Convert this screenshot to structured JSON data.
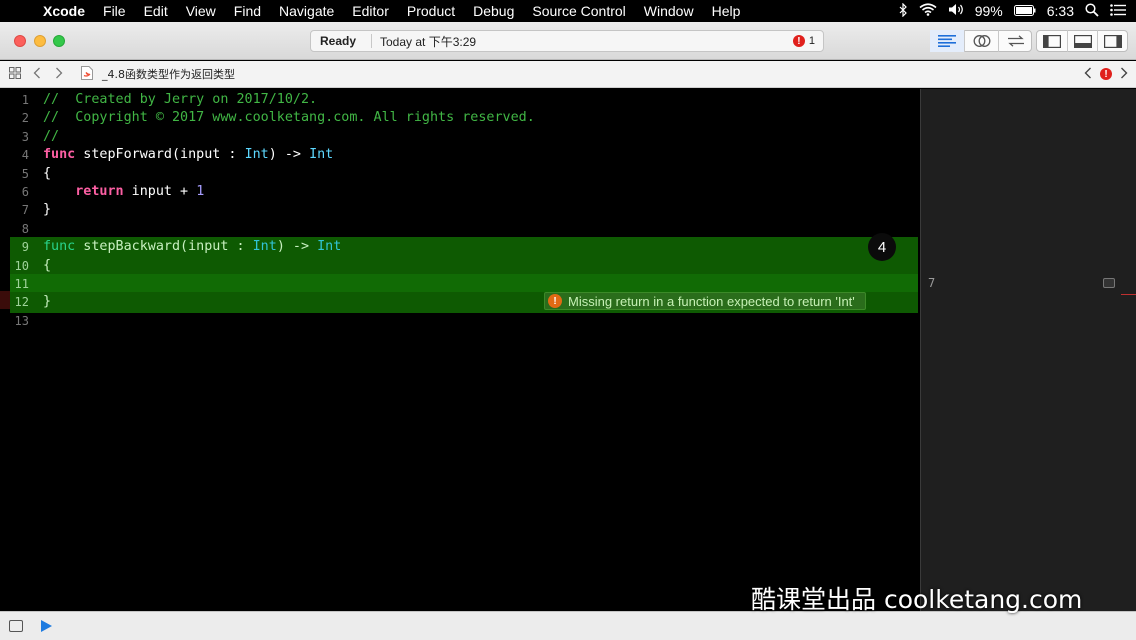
{
  "menubar": {
    "app": "Xcode",
    "items": [
      "File",
      "Edit",
      "View",
      "Find",
      "Navigate",
      "Editor",
      "Product",
      "Debug",
      "Source Control",
      "Window",
      "Help"
    ],
    "battery": "99%",
    "time": "6:33"
  },
  "toolbar": {
    "status": "Ready",
    "time": "Today at 下午3:29",
    "error_count": "1"
  },
  "jumpbar": {
    "file": "_4.8函数类型作为返回类型"
  },
  "editor": {
    "lines": [
      {
        "n": "1",
        "tokens": [
          {
            "t": "//  Created by Jerry on 2017/10/2.",
            "c": "comment"
          }
        ]
      },
      {
        "n": "2",
        "tokens": [
          {
            "t": "//  Copyright © 2017 www.coolketang.com. All rights reserved.",
            "c": "comment"
          }
        ]
      },
      {
        "n": "3",
        "tokens": [
          {
            "t": "//",
            "c": "comment"
          }
        ]
      },
      {
        "n": "4",
        "tokens": [
          {
            "t": "func",
            "c": "kw"
          },
          {
            "t": " stepForward(input : ",
            "c": ""
          },
          {
            "t": "Int",
            "c": "type"
          },
          {
            "t": ") -> ",
            "c": ""
          },
          {
            "t": "Int",
            "c": "type"
          }
        ]
      },
      {
        "n": "5",
        "tokens": [
          {
            "t": "{",
            "c": ""
          }
        ]
      },
      {
        "n": "6",
        "tokens": [
          {
            "t": "    ",
            "c": ""
          },
          {
            "t": "return",
            "c": "kw"
          },
          {
            "t": " input + ",
            "c": ""
          },
          {
            "t": "1",
            "c": "num"
          }
        ]
      },
      {
        "n": "7",
        "tokens": [
          {
            "t": "}",
            "c": ""
          }
        ]
      },
      {
        "n": "8",
        "tokens": []
      },
      {
        "n": "9",
        "hl": true,
        "tokens": [
          {
            "t": "func",
            "c": "kw2"
          },
          {
            "t": " stepBackward(input : ",
            "c": "plain"
          },
          {
            "t": "Int",
            "c": "type2"
          },
          {
            "t": ") -> ",
            "c": "plain"
          },
          {
            "t": "Int",
            "c": "type2"
          }
        ]
      },
      {
        "n": "10",
        "hl": true,
        "tokens": [
          {
            "t": "{",
            "c": "plain"
          }
        ]
      },
      {
        "n": "11",
        "hl": true,
        "tokens": []
      },
      {
        "n": "12",
        "hl": true,
        "tokens": [
          {
            "t": "}",
            "c": "plain"
          }
        ]
      },
      {
        "n": "13",
        "tokens": []
      }
    ],
    "step_badge": "4",
    "issue_message": "Missing return in a function expected to return 'Int'"
  },
  "results": {
    "value": "7"
  },
  "watermark": "酷课堂出品 coolketang.com",
  "colors": {
    "comment": "#41b645",
    "keyword": "#fc5fa3",
    "type": "#5dd8ff",
    "number": "#a79dff",
    "highlight": "#0e5a02",
    "error": "#e0201c"
  }
}
